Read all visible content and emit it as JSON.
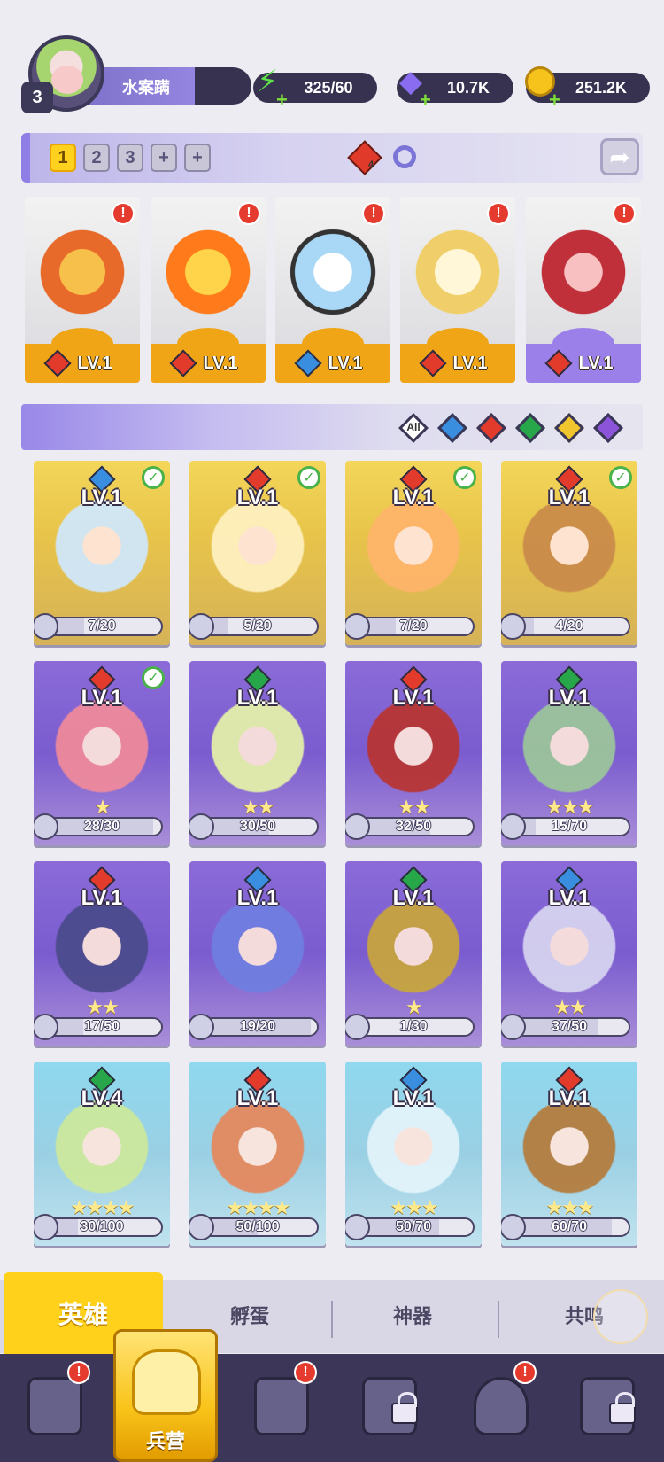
{
  "player": {
    "level": "3",
    "name": "水案蹒"
  },
  "resources": {
    "energy": "325/60",
    "gems": "10.7K",
    "coins": "251.2K"
  },
  "team_bar": {
    "slots": [
      "1",
      "2",
      "3",
      "+",
      "+"
    ],
    "active_slot": "1",
    "element_count": "4"
  },
  "team": [
    {
      "level": "LV.1",
      "element": "fire",
      "alert": true
    },
    {
      "level": "LV.1",
      "element": "fire",
      "alert": true
    },
    {
      "level": "LV.1",
      "element": "water",
      "alert": true
    },
    {
      "level": "LV.1",
      "element": "fire",
      "alert": true
    },
    {
      "level": "LV.1",
      "element": "fire",
      "alert": true
    }
  ],
  "filter": {
    "all_label": "All",
    "elements": [
      "water",
      "fire",
      "nature",
      "light",
      "dark"
    ]
  },
  "heroes": [
    {
      "level": "LV.1",
      "element": "water",
      "progress": "7/20",
      "check": true,
      "stars": "",
      "rarity": "gold"
    },
    {
      "level": "LV.1",
      "element": "fire",
      "progress": "5/20",
      "check": true,
      "stars": "",
      "rarity": "gold"
    },
    {
      "level": "LV.1",
      "element": "fire",
      "progress": "7/20",
      "check": true,
      "stars": "",
      "rarity": "gold"
    },
    {
      "level": "LV.1",
      "element": "fire",
      "progress": "4/20",
      "check": true,
      "stars": "",
      "rarity": "gold"
    },
    {
      "level": "LV.1",
      "element": "fire",
      "progress": "28/30",
      "check": true,
      "stars": "★",
      "rarity": "purple"
    },
    {
      "level": "LV.1",
      "element": "nature",
      "progress": "30/50",
      "check": false,
      "stars": "★★",
      "rarity": "purple"
    },
    {
      "level": "LV.1",
      "element": "fire",
      "progress": "32/50",
      "check": false,
      "stars": "★★",
      "rarity": "purple"
    },
    {
      "level": "LV.1",
      "element": "nature",
      "progress": "15/70",
      "check": false,
      "stars": "★★★",
      "rarity": "purple"
    },
    {
      "level": "LV.1",
      "element": "fire",
      "progress": "17/50",
      "check": false,
      "stars": "★★",
      "rarity": "purple"
    },
    {
      "level": "LV.1",
      "element": "water",
      "progress": "19/20",
      "check": false,
      "stars": "",
      "rarity": "purple"
    },
    {
      "level": "LV.1",
      "element": "nature",
      "progress": "1/30",
      "check": false,
      "stars": "★",
      "rarity": "purple"
    },
    {
      "level": "LV.1",
      "element": "water",
      "progress": "37/50",
      "check": false,
      "stars": "★★",
      "rarity": "purple"
    },
    {
      "level": "LV.4",
      "element": "nature",
      "progress": "30/100",
      "check": false,
      "stars": "★★★★",
      "rarity": "blue"
    },
    {
      "level": "LV.1",
      "element": "fire",
      "progress": "50/100",
      "check": false,
      "stars": "★★★★",
      "rarity": "blue"
    },
    {
      "level": "LV.1",
      "element": "water",
      "progress": "50/70",
      "check": false,
      "stars": "★★★",
      "rarity": "blue"
    },
    {
      "level": "LV.1",
      "element": "fire",
      "progress": "60/70",
      "check": false,
      "stars": "★★★",
      "rarity": "blue"
    }
  ],
  "subtabs": {
    "heroes": "英雄",
    "hatch": "孵蛋",
    "artifacts": "神器",
    "resonance": "共鸣"
  },
  "bottom_nav": {
    "barracks": "兵营"
  },
  "colors": {
    "fire": "#e23b2b",
    "water": "#3a8ee0",
    "nature": "#28a64a",
    "light": "#f1c52e",
    "dark": "#8c54d8",
    "accent": "#ffd11a",
    "nav_bg": "#3c3658"
  }
}
